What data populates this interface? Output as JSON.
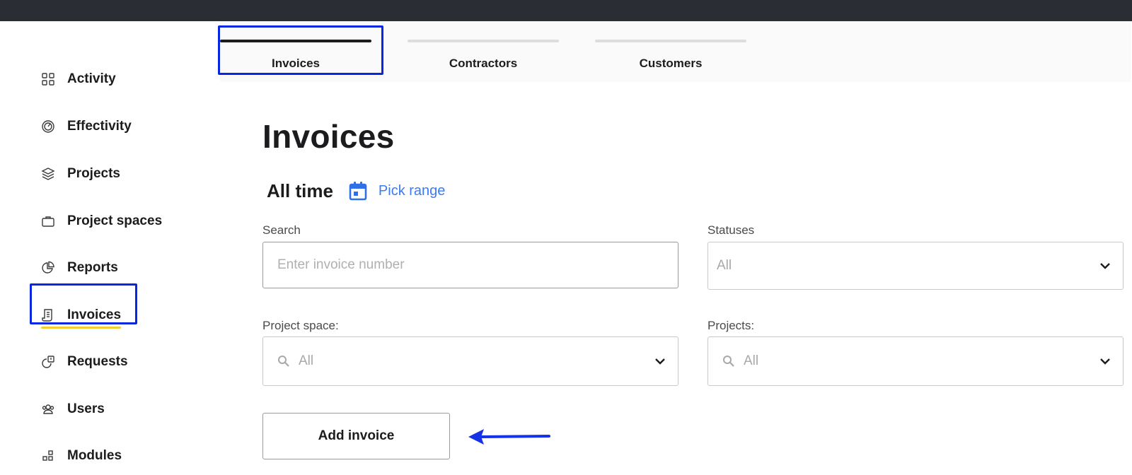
{
  "sidebar": {
    "items": [
      {
        "label": "Activity",
        "icon": "grid-icon"
      },
      {
        "label": "Effectivity",
        "icon": "gauge-icon"
      },
      {
        "label": "Projects",
        "icon": "layers-icon"
      },
      {
        "label": "Project spaces",
        "icon": "briefcase-icon"
      },
      {
        "label": "Reports",
        "icon": "pie-chart-icon"
      },
      {
        "label": "Invoices",
        "icon": "receipt-icon",
        "active": true
      },
      {
        "label": "Requests",
        "icon": "request-icon"
      },
      {
        "label": "Users",
        "icon": "users-icon"
      },
      {
        "label": "Modules",
        "icon": "modules-icon"
      }
    ]
  },
  "tabs": [
    {
      "label": "Invoices",
      "active": true
    },
    {
      "label": "Contractors"
    },
    {
      "label": "Customers"
    }
  ],
  "main": {
    "title": "Invoices",
    "range_label": "All time",
    "pick_range": "Pick range",
    "search": {
      "label": "Search",
      "placeholder": "Enter invoice number"
    },
    "statuses": {
      "label": "Statuses",
      "value": "All"
    },
    "project_space": {
      "label": "Project space:",
      "value": "All"
    },
    "projects": {
      "label": "Projects:",
      "value": "All"
    },
    "add_invoice": "Add invoice"
  },
  "colors": {
    "accent_blue": "#3b7cf0",
    "highlight_blue": "#0a27e0",
    "active_underline": "#f2cf2f",
    "topbar": "#2b2d35"
  }
}
